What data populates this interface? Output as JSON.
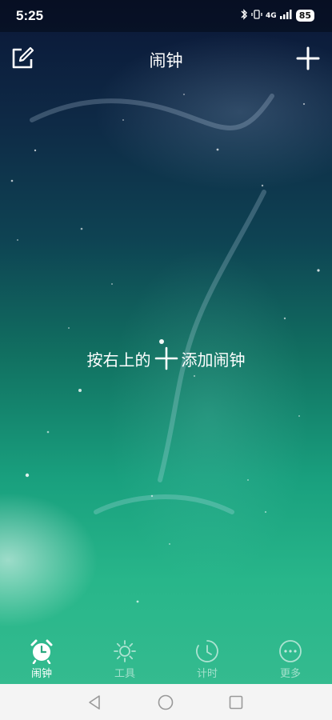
{
  "status_bar": {
    "time": "5:25",
    "network": "4G",
    "battery": "85"
  },
  "header": {
    "title": "闹钟",
    "edit_icon": "edit-icon",
    "add_icon": "plus-icon"
  },
  "empty_state": {
    "text_before": "按右上的",
    "text_after": "添加闹钟",
    "icon": "plus-icon"
  },
  "bottom_nav": {
    "items": [
      {
        "label": "闹钟",
        "icon": "alarm-clock-icon",
        "active": true
      },
      {
        "label": "工具",
        "icon": "sun-icon",
        "active": false
      },
      {
        "label": "计时",
        "icon": "timer-icon",
        "active": false
      },
      {
        "label": "更多",
        "icon": "more-icon",
        "active": false
      }
    ]
  },
  "system_nav": {
    "back_icon": "back-triangle-icon",
    "home_icon": "home-circle-icon",
    "recents_icon": "recents-square-icon"
  },
  "colors": {
    "background_top": "#0b1737",
    "background_bottom": "#34bb8f",
    "text": "#ffffff",
    "system_nav_bg": "#f4f4f4"
  }
}
